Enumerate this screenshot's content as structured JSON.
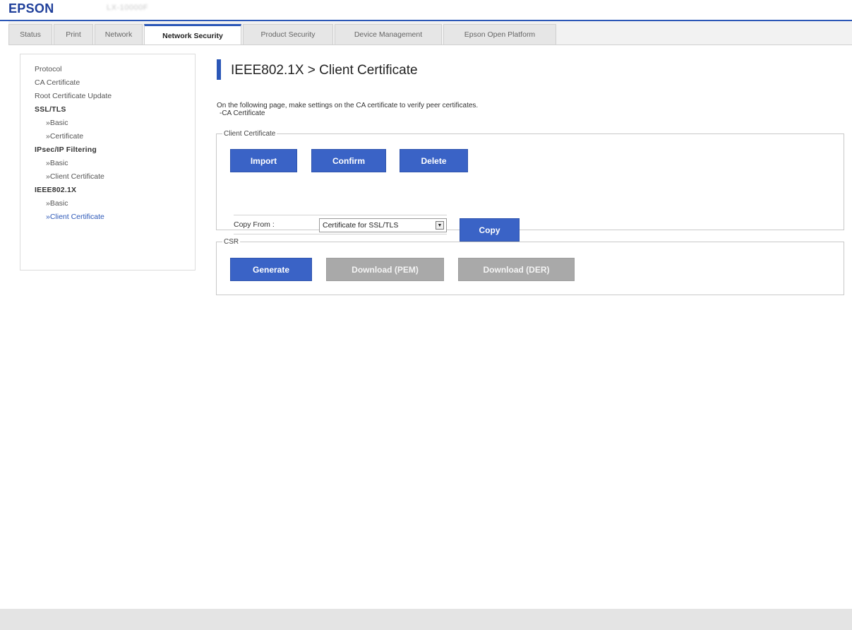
{
  "header": {
    "logo": "EPSON",
    "model": "LX-10000F"
  },
  "tabs": [
    {
      "label": "Status"
    },
    {
      "label": "Print"
    },
    {
      "label": "Network"
    },
    {
      "label": "Network Security"
    },
    {
      "label": "Product Security"
    },
    {
      "label": "Device Management"
    },
    {
      "label": "Epson Open Platform"
    }
  ],
  "sidebar": {
    "items": [
      {
        "label": "Protocol"
      },
      {
        "label": "CA Certificate"
      },
      {
        "label": "Root Certificate Update"
      },
      {
        "label": "SSL/TLS"
      },
      {
        "label": "»Basic"
      },
      {
        "label": "»Certificate"
      },
      {
        "label": "IPsec/IP Filtering"
      },
      {
        "label": "»Basic"
      },
      {
        "label": "»Client Certificate"
      },
      {
        "label": "IEEE802.1X"
      },
      {
        "label": "»Basic"
      },
      {
        "label": "»Client Certificate"
      }
    ]
  },
  "main": {
    "title": "IEEE802.1X > Client Certificate",
    "desc_line1": "On the following page, make settings on the CA certificate to verify peer certificates.",
    "desc_line2": "-CA Certificate",
    "client_cert": {
      "legend": "Client Certificate",
      "import_label": "Import",
      "confirm_label": "Confirm",
      "delete_label": "Delete",
      "copy_from_label": "Copy From :",
      "copy_from_value": "Certificate for SSL/TLS",
      "copy_label": "Copy"
    },
    "csr": {
      "legend": "CSR",
      "generate_label": "Generate",
      "download_pem_label": "Download (PEM)",
      "download_der_label": "Download (DER)"
    }
  }
}
